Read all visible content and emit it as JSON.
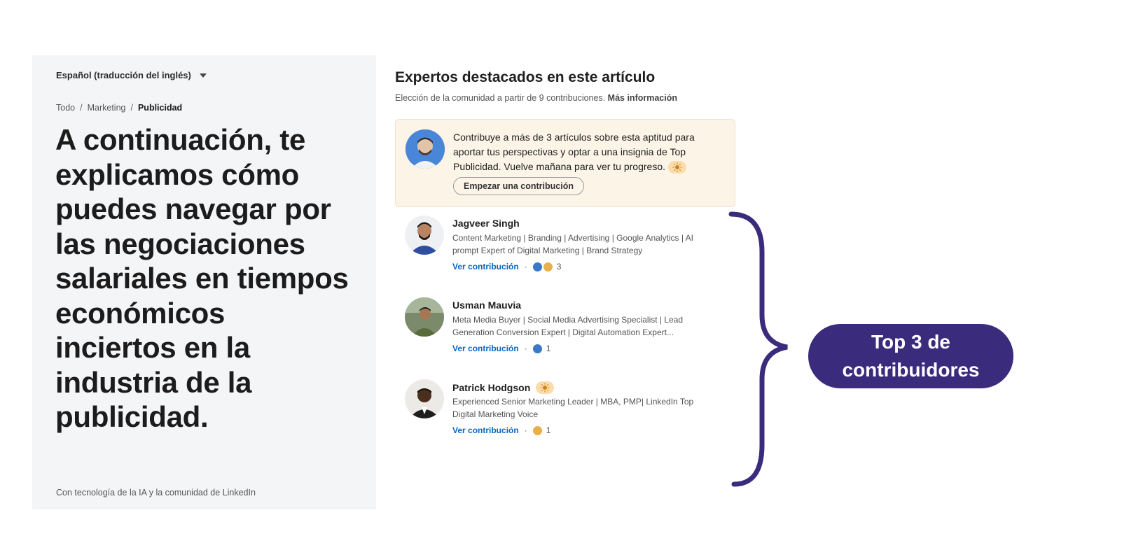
{
  "left": {
    "language": "Español (traducción del inglés)",
    "breadcrumb": [
      "Todo",
      "Marketing",
      "Publicidad"
    ],
    "headline": "A continuación, te explicamos cómo puedes navegar por las negociaciones salariales en tiempos económicos inciertos en la industria de la publicidad.",
    "powered_by": "Con tecnología de la IA y la comunidad de LinkedIn"
  },
  "experts": {
    "title": "Expertos destacados en este artículo",
    "subtitle": "Elección de la comunidad a partir de 9 contribuciones.",
    "more_link": "Más información"
  },
  "cta": {
    "text": "Contribuye a más de 3 artículos sobre esta aptitud para aportar tus perspectivas y optar a una insignia de Top Publicidad. Vuelve mañana para ver tu progreso.",
    "button": "Empezar una contribución"
  },
  "contributors": [
    {
      "name": "Jagveer Singh",
      "description": "Content Marketing | Branding | Advertising | Google Analytics | AI prompt Expert of Digital Marketing | Brand Strategy",
      "link": "Ver contribución",
      "badge_count": "3",
      "avatar_color": "#2f4f9e"
    },
    {
      "name": "Usman Mauvia",
      "description": "Meta Media Buyer | Social Media Advertising Specialist | Lead Generation Conversion Expert | Digital Automation Expert...",
      "link": "Ver contribución",
      "badge_count": "1",
      "avatar_color": "#5a6b3a"
    },
    {
      "name": "Patrick Hodgson",
      "description": "Experienced Senior Marketing Leader | MBA, PMP| LinkedIn Top Digital Marketing Voice",
      "link": "Ver contribución",
      "badge_count": "1",
      "avatar_color": "#2c2c2c"
    }
  ],
  "annotation": {
    "label": "Top 3 de contribuidores",
    "color": "#3a2b7c"
  }
}
